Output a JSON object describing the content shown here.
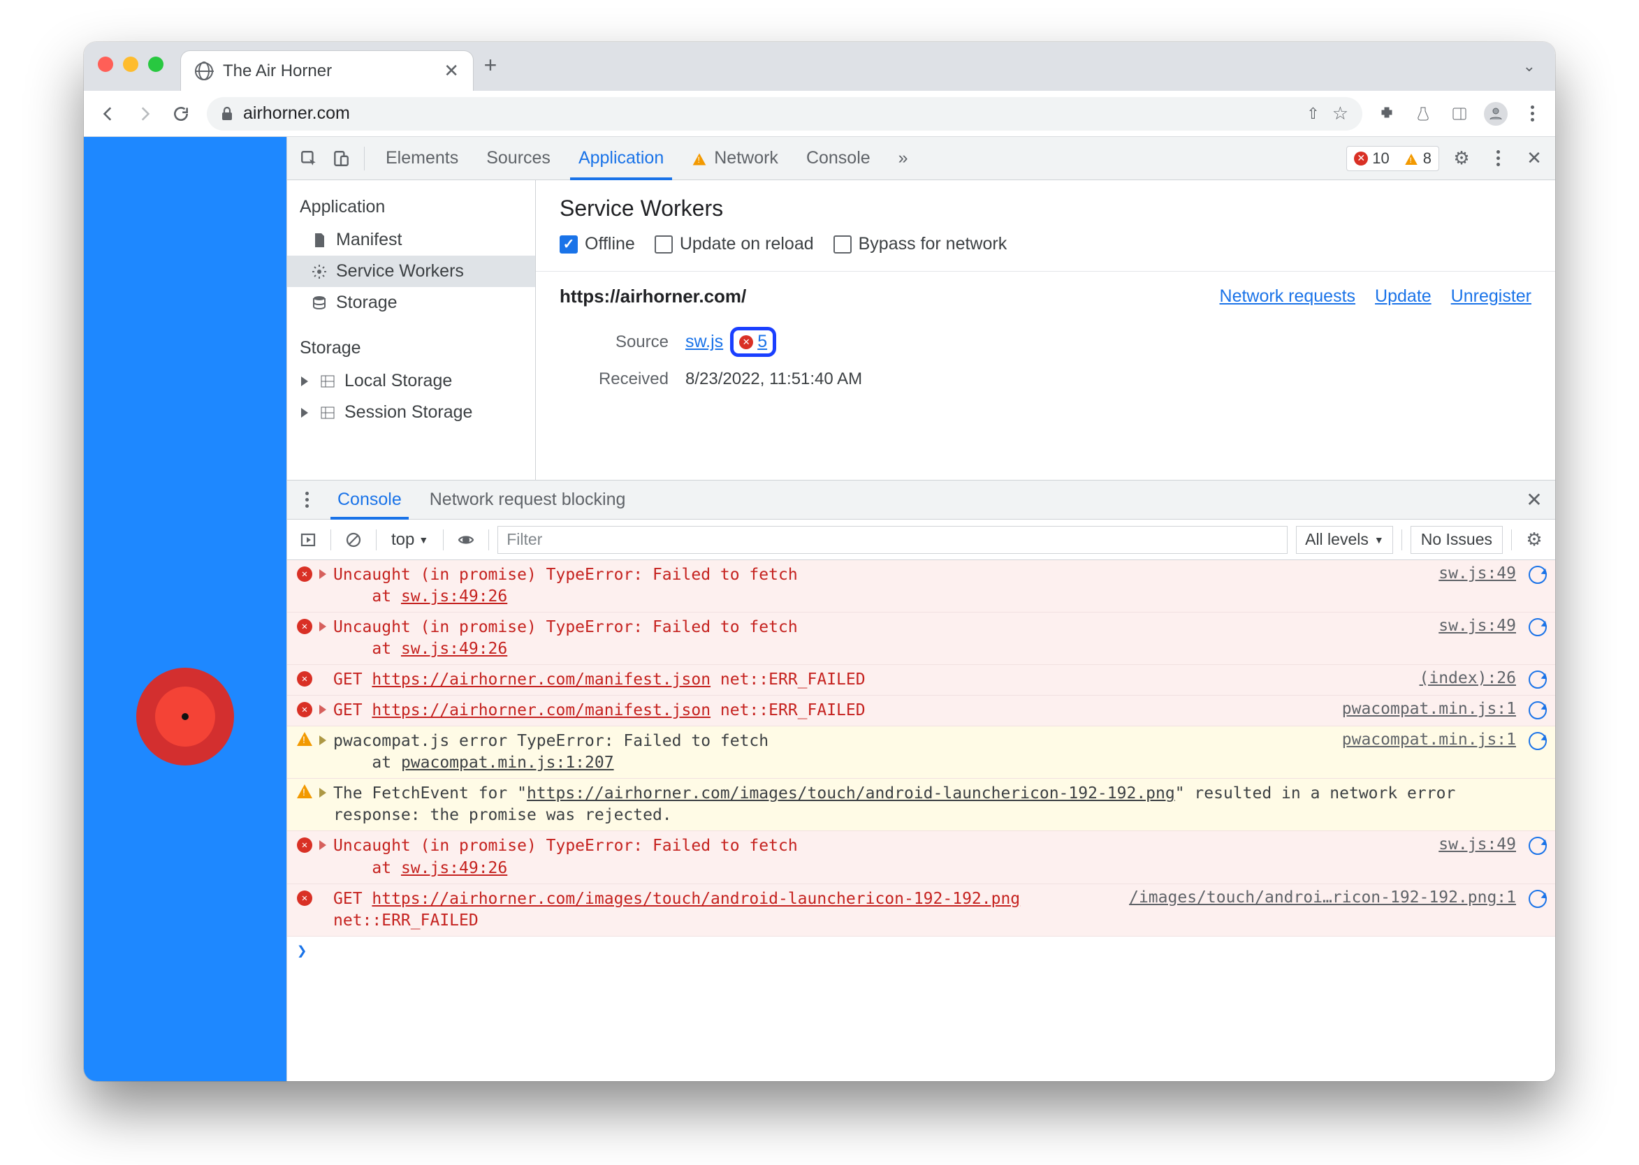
{
  "tab": {
    "title": "The Air Horner"
  },
  "url": "airhorner.com",
  "devtools": {
    "tabs": {
      "elements": "Elements",
      "sources": "Sources",
      "application": "Application",
      "network": "Network",
      "console": "Console"
    },
    "error_count": "10",
    "warn_count": "8"
  },
  "sidebar": {
    "app_header": "Application",
    "manifest": "Manifest",
    "sw": "Service Workers",
    "storage": "Storage",
    "storage_header": "Storage",
    "local": "Local Storage",
    "session": "Session Storage"
  },
  "sw": {
    "title": "Service Workers",
    "offline": "Offline",
    "update": "Update on reload",
    "bypass": "Bypass for network",
    "origin": "https://airhorner.com/",
    "links": {
      "net": "Network requests",
      "upd": "Update",
      "unreg": "Unregister"
    },
    "source_label": "Source",
    "source_file": "sw.js",
    "error_count": "5",
    "received_label": "Received",
    "received_value": "8/23/2022, 11:51:40 AM"
  },
  "drawer": {
    "console": "Console",
    "blocking": "Network request blocking"
  },
  "console_toolbar": {
    "context": "top",
    "filter": "Filter",
    "levels": "All levels",
    "issues": "No Issues"
  },
  "console": [
    {
      "type": "err",
      "expand": true,
      "text": "Uncaught (in promise) TypeError: Failed to fetch\n    at ",
      "link_inline": "sw.js:49:26",
      "src": "sw.js:49"
    },
    {
      "type": "err",
      "expand": true,
      "text": "Uncaught (in promise) TypeError: Failed to fetch\n    at ",
      "link_inline": "sw.js:49:26",
      "src": "sw.js:49"
    },
    {
      "type": "err",
      "expand": false,
      "text": "GET ",
      "link_inline": "https://airhorner.com/manifest.json",
      "suffix": " net::ERR_FAILED",
      "src": "(index):26"
    },
    {
      "type": "err",
      "expand": true,
      "text": "GET ",
      "link_inline": "https://airhorner.com/manifest.json",
      "suffix": " net::ERR_FAILED",
      "src": "pwacompat.min.js:1"
    },
    {
      "type": "warn",
      "expand": true,
      "text": "pwacompat.js error TypeError: Failed to fetch\n    at ",
      "link_inline": "pwacompat.min.js:1:207",
      "src": "pwacompat.min.js:1"
    },
    {
      "type": "warn",
      "expand": true,
      "text": "The FetchEvent for \"",
      "link_inline": "https://airhorner.com/images/touch/android-launchericon-192-192.png",
      "suffix": "\" resulted in a network error response: the promise was rejected.",
      "src": ""
    },
    {
      "type": "err",
      "expand": true,
      "text": "Uncaught (in promise) TypeError: Failed to fetch\n    at ",
      "link_inline": "sw.js:49:26",
      "src": "sw.js:49"
    },
    {
      "type": "err",
      "expand": false,
      "text": "GET ",
      "link_inline": "https://airhorner.com/images/touch/android-launchericon-192-192.png",
      "suffix": " net::ERR_FAILED",
      "src": "/images/touch/androi…ricon-192-192.png:1"
    }
  ]
}
